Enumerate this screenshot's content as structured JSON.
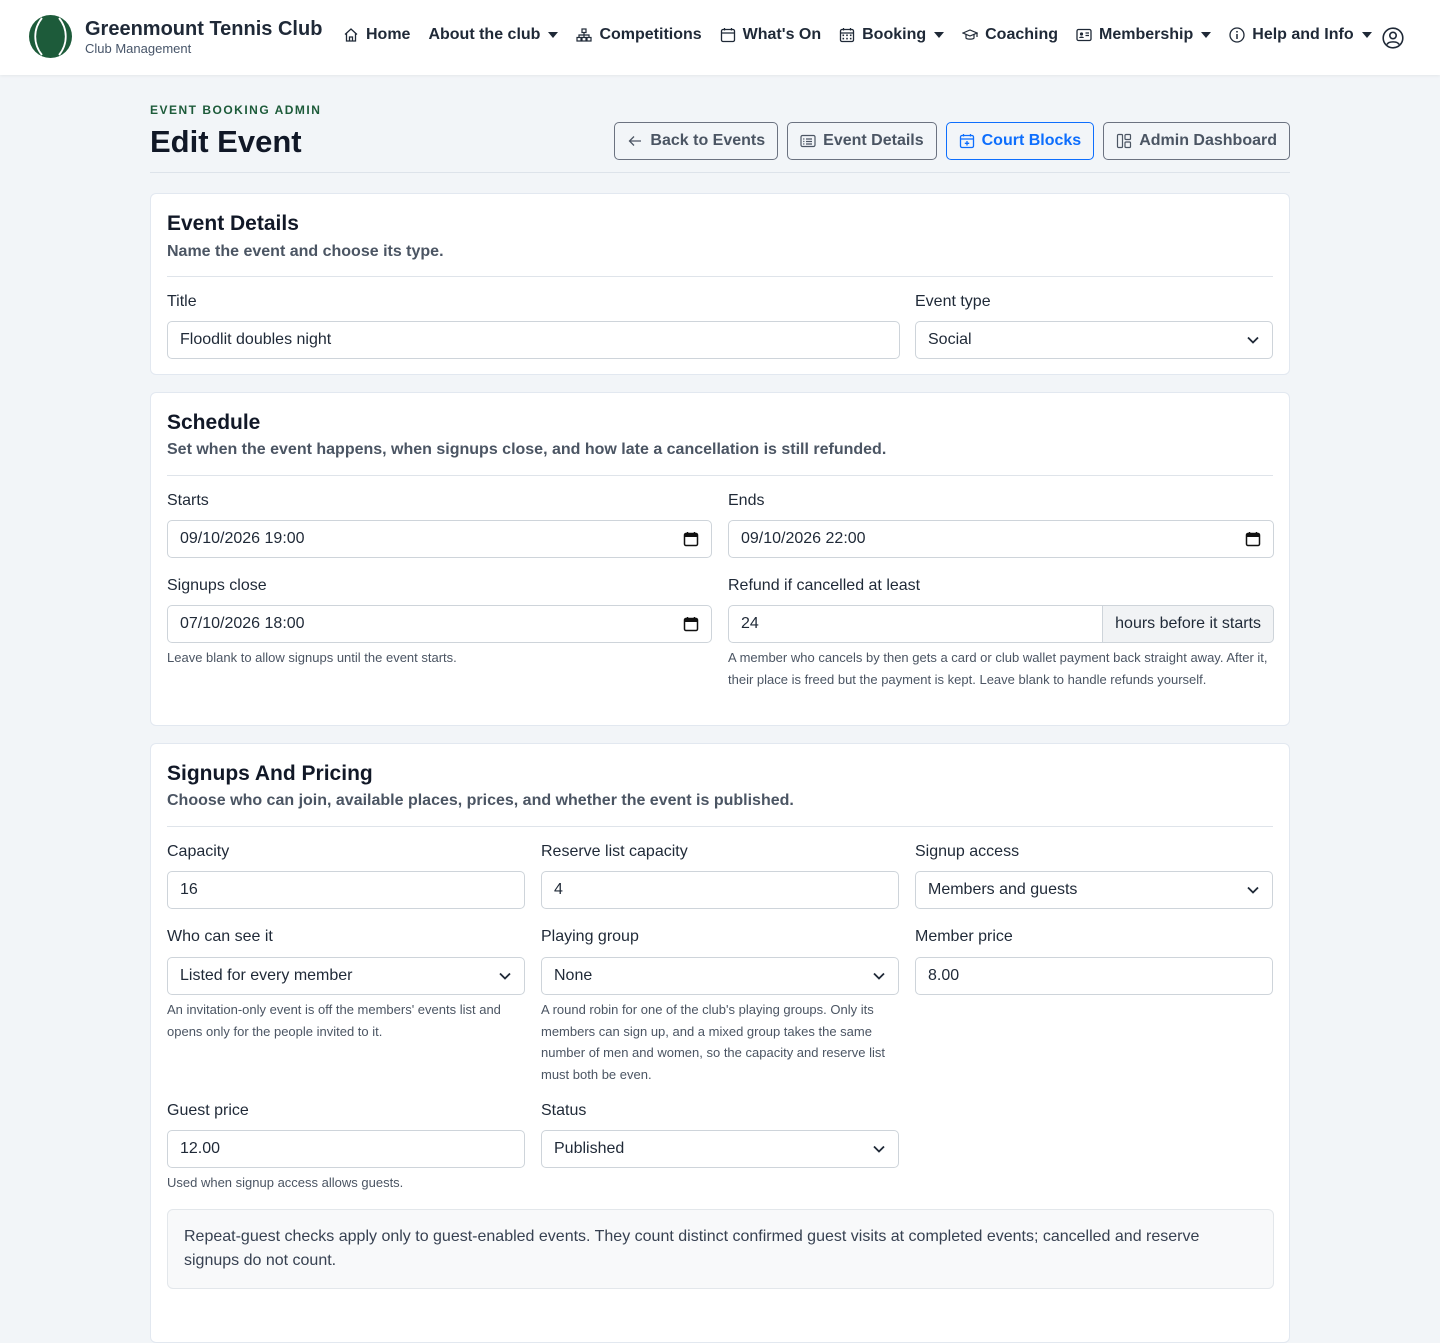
{
  "nav": {
    "brand_name": "Greenmount Tennis Club",
    "brand_sub": "Club Management",
    "items": [
      {
        "label": "Home",
        "icon": "home-icon",
        "dropdown": false
      },
      {
        "label": "About the club",
        "icon": "",
        "dropdown": true
      },
      {
        "label": "Competitions",
        "icon": "sitemap-icon",
        "dropdown": false
      },
      {
        "label": "What's On",
        "icon": "calendar-icon",
        "dropdown": false
      },
      {
        "label": "Booking",
        "icon": "calendar-grid-icon",
        "dropdown": true
      },
      {
        "label": "Coaching",
        "icon": "mortarboard-icon",
        "dropdown": false
      },
      {
        "label": "Membership",
        "icon": "id-card-icon",
        "dropdown": true
      },
      {
        "label": "Help and Info",
        "icon": "info-icon",
        "dropdown": true
      }
    ]
  },
  "header": {
    "eyebrow": "EVENT BOOKING ADMIN",
    "title": "Edit Event",
    "buttons": {
      "back": "Back to Events",
      "details": "Event Details",
      "court_blocks": "Court Blocks",
      "dashboard": "Admin Dashboard"
    }
  },
  "event_details": {
    "title": "Event Details",
    "subtitle": "Name the event and choose its type.",
    "title_label": "Title",
    "title_value": "Floodlit doubles night",
    "type_label": "Event type",
    "type_value": "Social"
  },
  "schedule": {
    "title": "Schedule",
    "subtitle": "Set when the event happens, when signups close, and how late a cancellation is still refunded.",
    "starts_label": "Starts",
    "starts_value": "09/10/2026 19:00",
    "ends_label": "Ends",
    "ends_value": "09/10/2026 22:00",
    "signups_close_label": "Signups close",
    "signups_close_value": "07/10/2026 18:00",
    "signups_close_help": "Leave blank to allow signups until the event starts.",
    "refund_label": "Refund if cancelled at least",
    "refund_value": "24",
    "refund_addon": "hours before it starts",
    "refund_help": "A member who cancels by then gets a card or club wallet payment back straight away. After it, their place is freed but the payment is kept. Leave blank to handle refunds yourself."
  },
  "signups": {
    "title": "Signups And Pricing",
    "subtitle": "Choose who can join, available places, prices, and whether the event is published.",
    "capacity_label": "Capacity",
    "capacity_value": "16",
    "reserve_label": "Reserve list capacity",
    "reserve_value": "4",
    "access_label": "Signup access",
    "access_value": "Members and guests",
    "visibility_label": "Who can see it",
    "visibility_value": "Listed for every member",
    "visibility_help": "An invitation-only event is off the members' events list and opens only for the people invited to it.",
    "group_label": "Playing group",
    "group_value": "None",
    "group_help": "A round robin for one of the club's playing groups. Only its members can sign up, and a mixed group takes the same number of men and women, so the capacity and reserve list must both be even.",
    "member_price_label": "Member price",
    "member_price_value": "8.00",
    "guest_price_label": "Guest price",
    "guest_price_value": "12.00",
    "guest_price_help": "Used when signup access allows guests.",
    "status_label": "Status",
    "status_value": "Published",
    "notice": "Repeat-guest checks apply only to guest-enabled events. They count distinct confirmed guest visits at completed events; cancelled and reserve signups do not count."
  },
  "colors": {
    "brand_green": "#1d5b3a",
    "accent_blue": "#0d6efd",
    "page_bg": "#f2f5f8"
  }
}
